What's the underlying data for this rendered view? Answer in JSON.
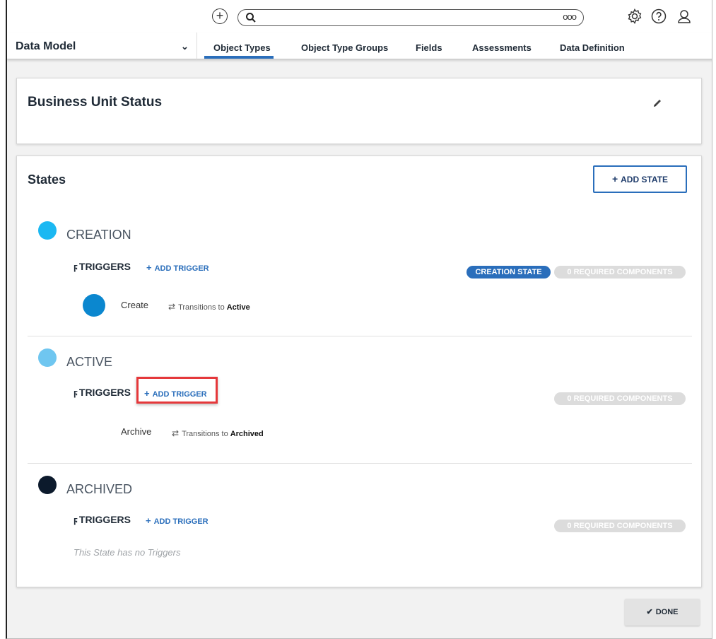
{
  "topbar": {
    "add_icon": "plus-circle-icon",
    "search_icon": "search-icon",
    "more_label": "ooo",
    "settings_icon": "gear-icon",
    "help_icon": "help-icon",
    "user_icon": "user-icon"
  },
  "nav": {
    "title": "Data Model",
    "tabs": [
      {
        "label": "Object Types",
        "active": true
      },
      {
        "label": "Object Type Groups"
      },
      {
        "label": "Fields"
      },
      {
        "label": "Assessments"
      },
      {
        "label": "Data Definition"
      }
    ]
  },
  "header": {
    "title": "Business Unit Status"
  },
  "states_section": {
    "title": "States",
    "add_state_label": "ADD STATE",
    "states": [
      {
        "name": "CREATION",
        "color": "#1bb8f2",
        "triggers_label": "TRIGGERS",
        "add_trigger_label": "ADD TRIGGER",
        "badges": [
          "CREATION STATE",
          "0 REQUIRED COMPONENTS"
        ],
        "triggers": [
          {
            "name": "Create",
            "transition_text": "Transitions to",
            "target": "Active"
          }
        ]
      },
      {
        "name": "ACTIVE",
        "color": "#6fc6f0",
        "triggers_label": "TRIGGERS",
        "add_trigger_label": "ADD TRIGGER",
        "badges": [
          "0 REQUIRED COMPONENTS"
        ],
        "triggers": [
          {
            "name": "Archive",
            "transition_text": "Transitions to",
            "target": "Archived"
          }
        ]
      },
      {
        "name": "ARCHIVED",
        "color": "#0c1a2c",
        "triggers_label": "TRIGGERS",
        "add_trigger_label": "ADD TRIGGER",
        "badges": [
          "0 REQUIRED COMPONENTS"
        ],
        "empty_text": "This State has no Triggers"
      }
    ]
  },
  "footer": {
    "done_label": "DONE"
  }
}
